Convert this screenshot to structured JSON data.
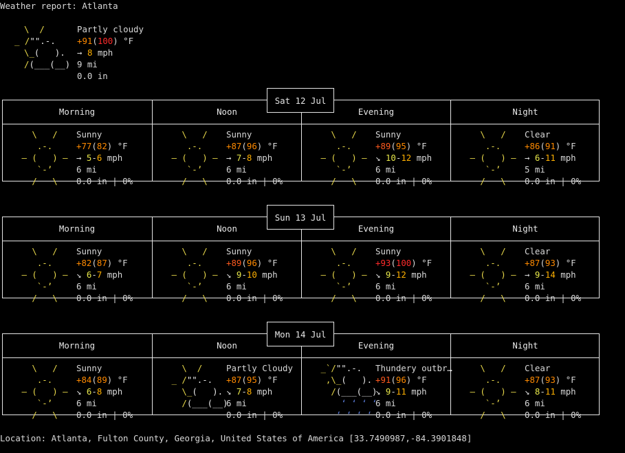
{
  "title": "Weather report: Atlanta",
  "current": {
    "condition": "Partly cloudy",
    "temp": "+91",
    "feels": "100",
    "unit": " °F",
    "wind_arrow": "→",
    "wind": "8",
    "wind_unit": " mph",
    "visibility": "9 mi",
    "precip": "0.0 in"
  },
  "days": [
    {
      "date": "Sat 12 Jul",
      "periods": [
        {
          "name": "Morning",
          "icon": "sunny-icon",
          "condition": "Sunny",
          "temp": "+77",
          "feels": "82",
          "wind_arrow": "→",
          "wind": "5-6",
          "vis": "6 mi",
          "precip": "0.0 in | 0%"
        },
        {
          "name": "Noon",
          "icon": "sunny-icon",
          "condition": "Sunny",
          "temp": "+87",
          "feels": "96",
          "wind_arrow": "→",
          "wind": "7-8",
          "vis": "6 mi",
          "precip": "0.0 in | 0%"
        },
        {
          "name": "Evening",
          "icon": "sunny-icon",
          "condition": "Sunny",
          "temp": "+89",
          "feels": "95",
          "wind_arrow": "↘",
          "wind": "10-12",
          "vis": "6 mi",
          "precip": "0.0 in | 0%"
        },
        {
          "name": "Night",
          "icon": "clear-icon",
          "condition": "Clear",
          "temp": "+86",
          "feels": "91",
          "wind_arrow": "→",
          "wind": "6-11",
          "vis": "5 mi",
          "precip": "0.0 in | 0%"
        }
      ]
    },
    {
      "date": "Sun 13 Jul",
      "periods": [
        {
          "name": "Morning",
          "icon": "sunny-icon",
          "condition": "Sunny",
          "temp": "+82",
          "feels": "87",
          "wind_arrow": "↘",
          "wind": "6-7",
          "vis": "6 mi",
          "precip": "0.0 in | 0%"
        },
        {
          "name": "Noon",
          "icon": "sunny-icon",
          "condition": "Sunny",
          "temp": "+89",
          "feels": "96",
          "wind_arrow": "↘",
          "wind": "9-10",
          "vis": "6 mi",
          "precip": "0.0 in | 0%"
        },
        {
          "name": "Evening",
          "icon": "sunny-icon",
          "condition": "Sunny",
          "temp": "+93",
          "feels": "100",
          "wind_arrow": "↘",
          "wind": "9-12",
          "vis": "6 mi",
          "precip": "0.0 in | 0%"
        },
        {
          "name": "Night",
          "icon": "clear-icon",
          "condition": "Clear",
          "temp": "+87",
          "feels": "93",
          "wind_arrow": "→",
          "wind": "9-14",
          "vis": "6 mi",
          "precip": "0.0 in | 0%"
        }
      ]
    },
    {
      "date": "Mon 14 Jul",
      "periods": [
        {
          "name": "Morning",
          "icon": "sunny-icon",
          "condition": "Sunny",
          "temp": "+84",
          "feels": "89",
          "wind_arrow": "↘",
          "wind": "6-8",
          "vis": "6 mi",
          "precip": "0.0 in | 0%"
        },
        {
          "name": "Noon",
          "icon": "partly-cloudy-icon",
          "condition": "Partly Cloudy",
          "temp": "+87",
          "feels": "95",
          "wind_arrow": "↘",
          "wind": "7-8",
          "vis": "6 mi",
          "precip": "0.0 in | 0%"
        },
        {
          "name": "Evening",
          "icon": "thundery-icon",
          "condition": "Thundery outbr…",
          "temp": "+91",
          "feels": "96",
          "wind_arrow": "↘",
          "wind": "9-11",
          "vis": "6 mi",
          "precip": "0.0 in | 0%"
        },
        {
          "name": "Night",
          "icon": "clear-icon",
          "condition": "Clear",
          "temp": "+87",
          "feels": "93",
          "wind_arrow": "↘",
          "wind": "8-11",
          "vis": "6 mi",
          "precip": "0.0 in | 0%"
        }
      ]
    }
  ],
  "location": "Location: Atlanta, Fulton County, Georgia, United States of America [33.7490987,-84.3901848]"
}
